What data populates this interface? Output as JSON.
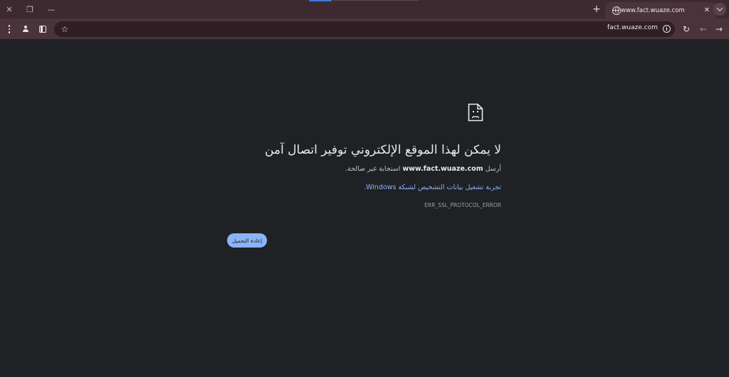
{
  "browser": {
    "window_controls": {
      "close_glyph": "✕",
      "restore_glyph": "❐",
      "minimize_glyph": "—"
    },
    "tab": {
      "title": "www.fact.wuaze.com",
      "close_glyph": "✕"
    },
    "new_tab_glyph": "+",
    "toolbar": {
      "star_glyph": "☆",
      "reload_glyph": "↻",
      "back_glyph": "←",
      "forward_glyph": "→",
      "info_glyph": "i"
    },
    "address": "fact.wuaze.com"
  },
  "error_page": {
    "title": "لا يمكن لهذا الموقع الإلكتروني توفير اتصال آمن",
    "description_prefix": "أرسل ",
    "description_host": "www.fact.wuaze.com",
    "description_suffix": " استجابة غير صالحة.",
    "diagnostics_link": "تجربة تشغيل بيانات التشخيص لشبكة Windows.",
    "error_code": "ERR_SSL_PROTOCOL_ERROR",
    "reload_button": "إعادة التحميل"
  },
  "colors": {
    "frame": "#3c2a30",
    "toolbar": "#4a343b",
    "page_bg": "#202124",
    "link": "#8ab4f8",
    "button_bg": "#8ab4f8"
  },
  "icons": [
    "close-icon",
    "restore-icon",
    "minimize-icon",
    "globe-icon",
    "plus-icon",
    "chevron-down-icon",
    "menu-dots-icon",
    "profile-icon",
    "side-panel-icon",
    "star-icon",
    "info-icon",
    "reload-icon",
    "back-arrow-icon",
    "forward-arrow-icon",
    "sad-document-icon"
  ]
}
